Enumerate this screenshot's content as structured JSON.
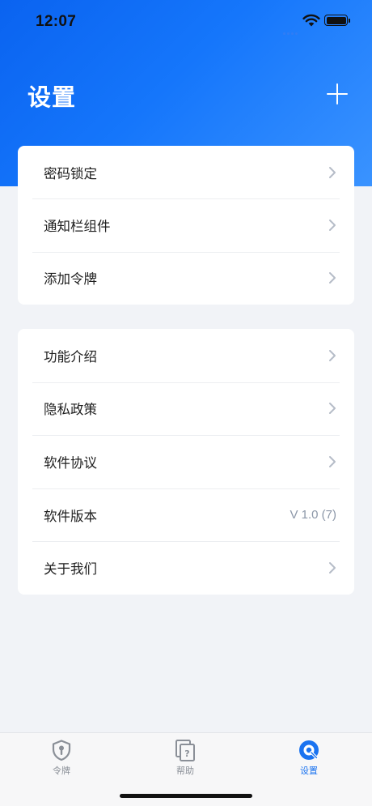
{
  "status_bar": {
    "time": "12:07"
  },
  "header": {
    "title": "设置",
    "add_icon": "plus-icon"
  },
  "groups": [
    {
      "items": [
        {
          "label": "密码锁定",
          "value": "",
          "icon": "chevron-right-icon"
        },
        {
          "label": "通知栏组件",
          "value": "",
          "icon": "chevron-right-icon"
        },
        {
          "label": "添加令牌",
          "value": "",
          "icon": "chevron-right-icon"
        }
      ]
    },
    {
      "items": [
        {
          "label": "功能介绍",
          "value": "",
          "icon": "chevron-right-icon"
        },
        {
          "label": "隐私政策",
          "value": "",
          "icon": "chevron-right-icon"
        },
        {
          "label": "软件协议",
          "value": "",
          "icon": "chevron-right-icon"
        },
        {
          "label": "软件版本",
          "value": "V 1.0 (7)",
          "icon": ""
        },
        {
          "label": "关于我们",
          "value": "",
          "icon": "chevron-right-icon"
        }
      ]
    }
  ],
  "tabbar": {
    "tabs": [
      {
        "label": "令牌",
        "icon": "shield-key-icon",
        "active": false
      },
      {
        "label": "帮助",
        "icon": "help-pages-icon",
        "active": false
      },
      {
        "label": "设置",
        "icon": "wrench-gear-icon",
        "active": true
      }
    ]
  },
  "colors": {
    "accent": "#1a73f0",
    "header_gradient_start": "#0a63f0",
    "header_gradient_end": "#3a93ff",
    "background": "#f1f3f7",
    "chevron": "#b5bcc7",
    "inactive_tab": "#8a8f97"
  }
}
